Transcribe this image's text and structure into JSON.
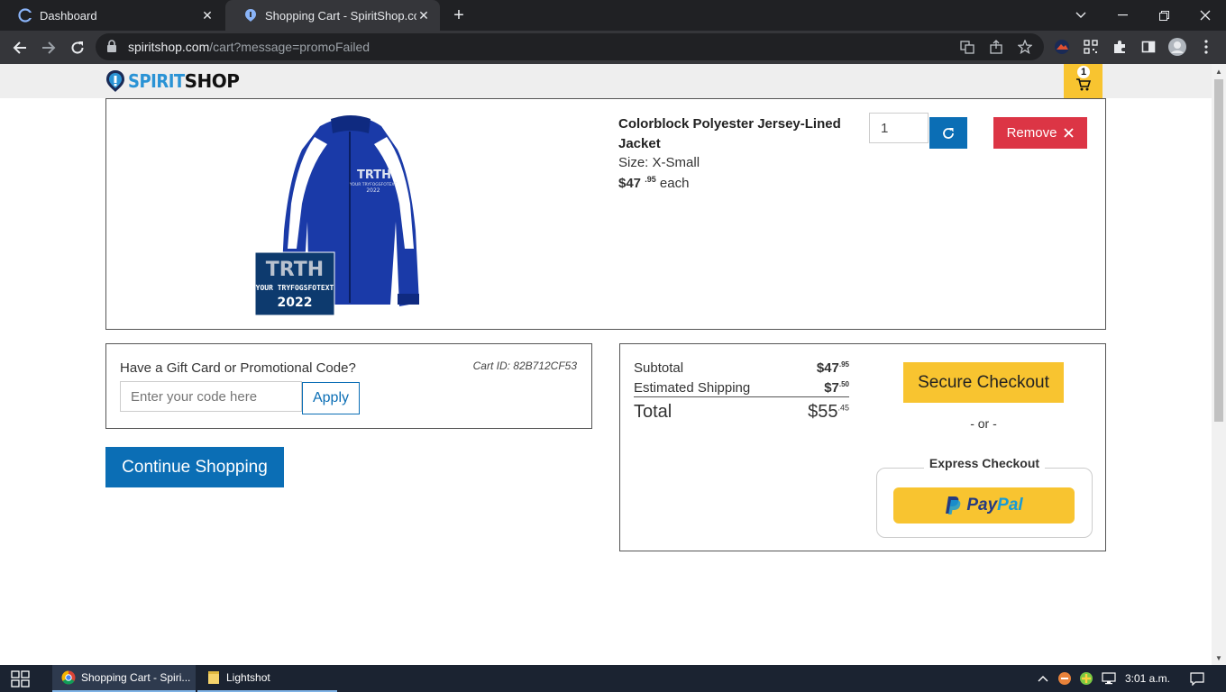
{
  "browser": {
    "tabs": [
      {
        "title": "Dashboard"
      },
      {
        "title": "Shopping Cart - SpiritShop.com"
      }
    ],
    "url_host": "spiritshop.com",
    "url_path": "/cart?message=promoFailed"
  },
  "site": {
    "logo_part1": "SPIRIT",
    "logo_part2": "SHOP",
    "cart_count": "1"
  },
  "cart_item": {
    "name": "Colorblock Polyester Jersey-Lined Jacket",
    "size": "Size: X-Small",
    "price_dollars": "$47",
    "price_cents": ".95",
    "price_suffix": "each",
    "quantity": "1",
    "remove_label": "Remove",
    "image_text": {
      "chest_line1": "TRTH",
      "chest_line2": "YOUR TRYFOGSFOTEXT",
      "chest_line3": "2022",
      "patch_line1": "TRTH",
      "patch_line2": "YOUR TRYFOGSFOTEXT",
      "patch_line3": "2022"
    }
  },
  "promo": {
    "title": "Have a Gift Card or Promotional Code?",
    "cart_id": "Cart ID: 82B712CF53",
    "placeholder": "Enter your code here",
    "apply_label": "Apply"
  },
  "continue_label": "Continue Shopping",
  "summary": {
    "subtotal_label": "Subtotal",
    "subtotal_dollars": "$47",
    "subtotal_cents": ".95",
    "shipping_label": "Estimated Shipping",
    "shipping_dollars": "$7",
    "shipping_cents": ".50",
    "total_label": "Total",
    "total_dollars": "$55",
    "total_cents": ".45",
    "secure_checkout_label": "Secure Checkout",
    "or_text": "- or -",
    "express_label": "Express Checkout",
    "paypal_part1": "Pay",
    "paypal_part2": "Pal"
  },
  "taskbar": {
    "items": [
      {
        "label": "Shopping Cart - Spiri..."
      },
      {
        "label": "Lightshot"
      }
    ],
    "clock": "3:01 a.m."
  },
  "colors": {
    "primary_blue": "#0b6eb5",
    "accent_yellow": "#f8c430",
    "remove_red": "#dc3545"
  }
}
